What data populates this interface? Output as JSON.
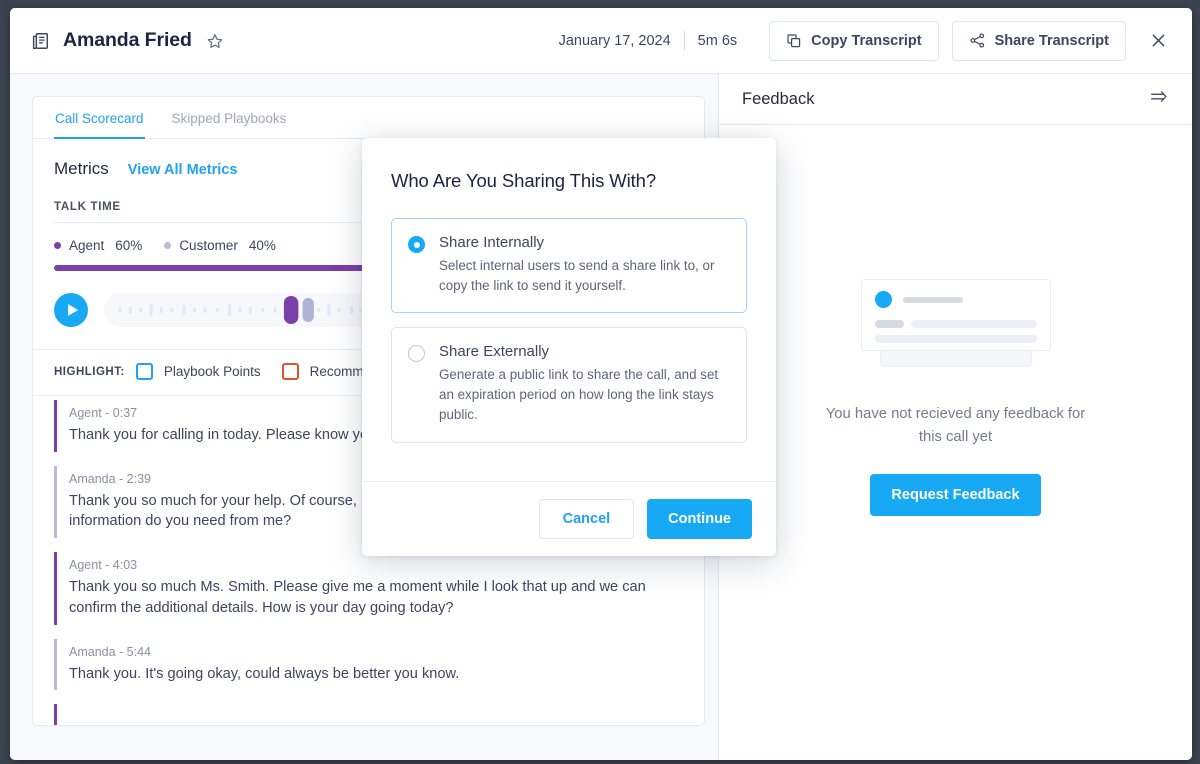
{
  "header": {
    "call_title": "Amanda Fried",
    "doc_icon": "document-icon",
    "star_icon": "star-outline-icon",
    "date": "January 17, 2024",
    "duration": "5m 6s",
    "copy_transcript_label": "Copy Transcript",
    "share_transcript_label": "Share Transcript",
    "close_icon": "close-icon"
  },
  "scorecard": {
    "tabs": [
      {
        "label": "Call Scorecard",
        "active": true
      },
      {
        "label": "Skipped Playbooks",
        "active": false
      }
    ],
    "metrics_title": "Metrics",
    "view_all_label": "View All Metrics",
    "talk_time_label": "TALK TIME",
    "talk_time": {
      "agent_label": "Agent",
      "agent_pct": "60%",
      "customer_label": "Customer",
      "customer_pct": "40%",
      "agent_color": "#7b3fa8",
      "customer_color": "#b9bdd4"
    },
    "player": {
      "play_icon": "play-icon",
      "accent_color": "#18a9f5"
    },
    "highlight": {
      "label": "HIGHLIGHT:",
      "options": [
        {
          "label": "Playbook Points",
          "color": "#21a1f6",
          "checked": false
        },
        {
          "label": "Recommended",
          "color": "#e2512c",
          "checked": false
        }
      ]
    },
    "transcript": [
      {
        "speaker": "Agent",
        "time": "- 0:37",
        "role": "agent",
        "text": "Thank you for calling in today. Please know you claim number so I can further assist you?"
      },
      {
        "speaker": "Amanda",
        "time": "- 2:39",
        "role": "customer",
        "text": "Thank you so much for your help. Of course, my claim number is A 244 521 B. What other information do you need from me?"
      },
      {
        "speaker": "Agent",
        "time": "- 4:03",
        "role": "agent",
        "text": "Thank you so much Ms. Smith. Please give me a moment while I look that up and we can confirm the additional details. How is your day going today?"
      },
      {
        "speaker": "Amanda",
        "time": "- 5:44",
        "role": "customer",
        "text": "Thank you. It's going okay, could always be better you know."
      }
    ]
  },
  "feedback": {
    "title": "Feedback",
    "collapse_icon": "collapse-panel-icon",
    "empty_text": "You have not recieved any feedback for this call yet",
    "request_button_label": "Request Feedback",
    "accent_color": "#18a9f5"
  },
  "modal": {
    "title": "Who Are You Sharing This With?",
    "options": [
      {
        "title": "Share Internally",
        "description": "Select internal users to send a share link to, or copy the link to send it yourself.",
        "selected": true
      },
      {
        "title": "Share Externally",
        "description": "Generate a public link to share the call, and set an expiration period on how long the link stays public.",
        "selected": false
      }
    ],
    "cancel_label": "Cancel",
    "continue_label": "Continue"
  }
}
